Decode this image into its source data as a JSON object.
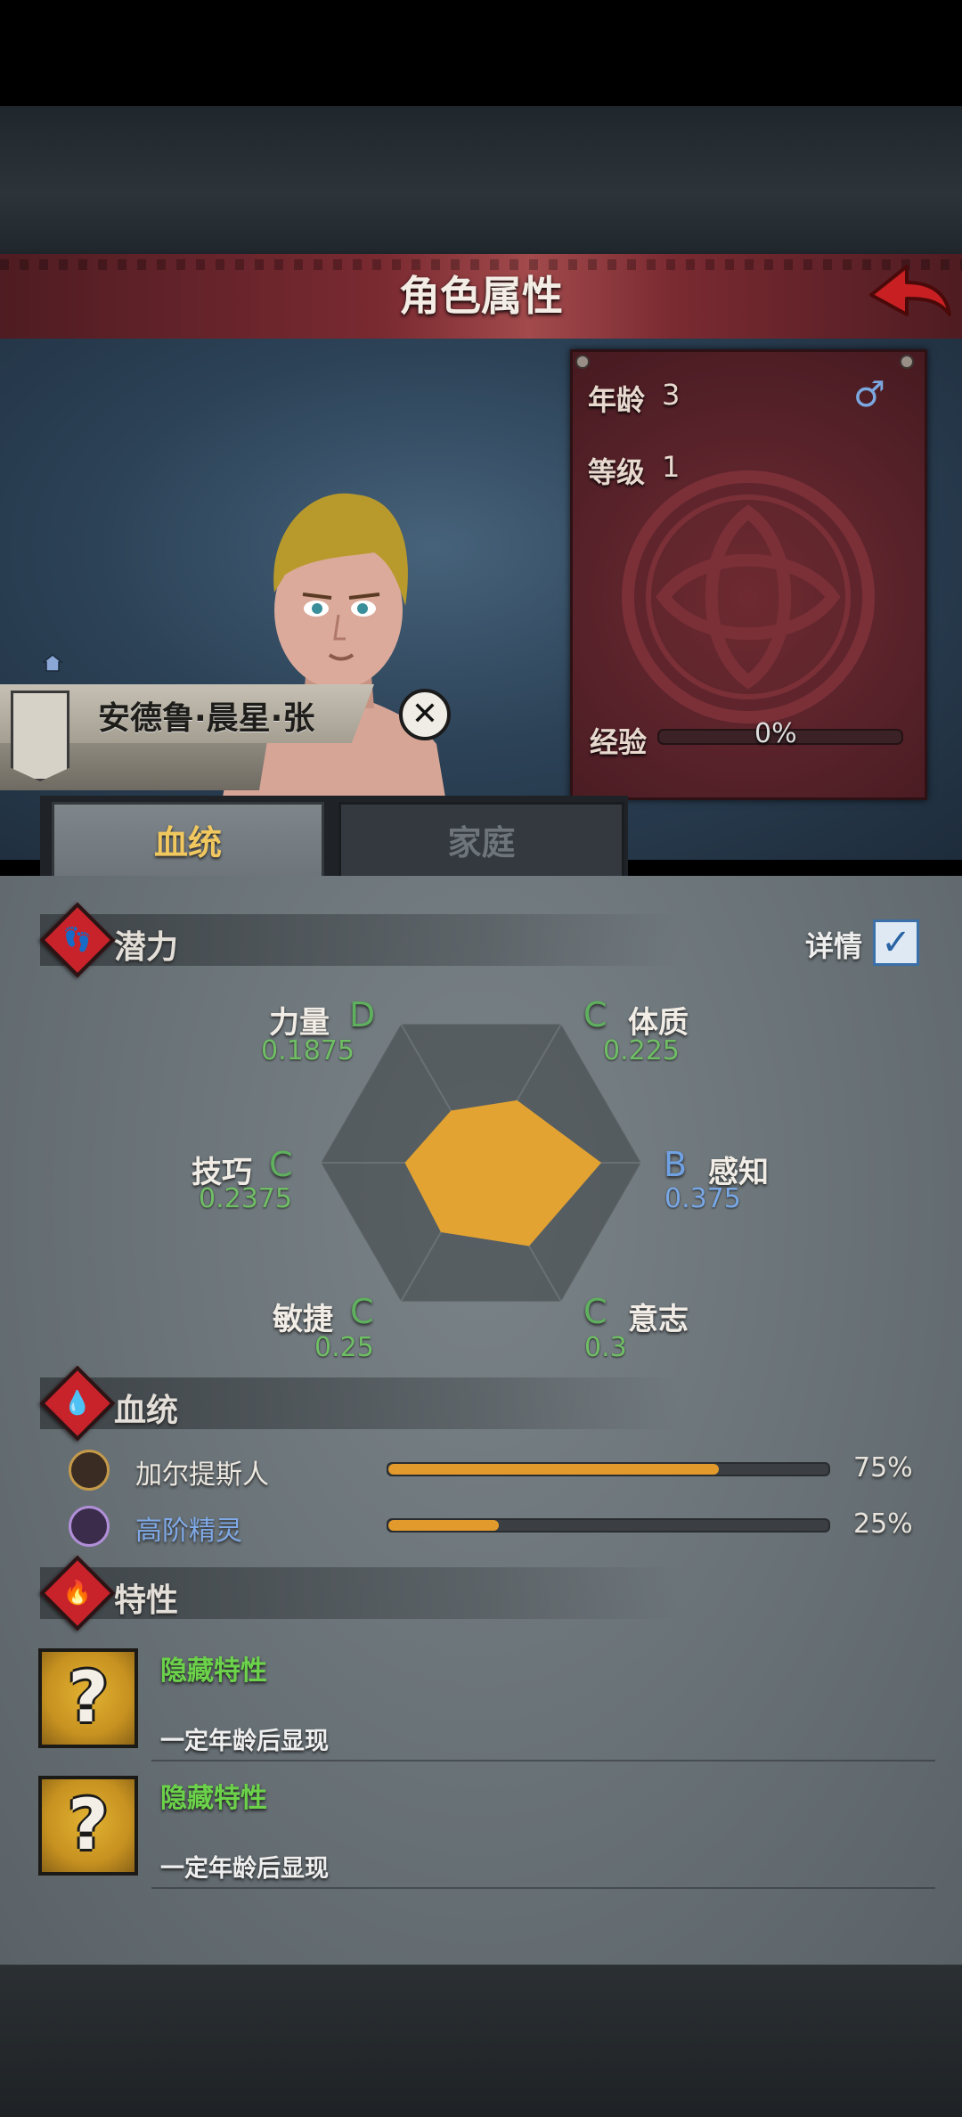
{
  "header": {
    "title": "角色属性"
  },
  "character": {
    "name": "安德鲁·晨星·张",
    "age_label": "年龄",
    "age_value": "3",
    "gender": "male",
    "gender_symbol": "♂",
    "level_label": "等级",
    "level_value": "1",
    "exp_label": "经验",
    "exp_percent_text": "0%",
    "exp_fraction": 0
  },
  "tabs": [
    {
      "label": "血统",
      "active": true
    },
    {
      "label": "家庭",
      "active": false
    }
  ],
  "potential": {
    "title": "潜力",
    "detail_label": "详情",
    "detail_checked": true,
    "attributes": [
      {
        "key": "strength",
        "name": "力量",
        "grade": "D",
        "value": "0.1875",
        "color": "green"
      },
      {
        "key": "constitution",
        "name": "体质",
        "grade": "C",
        "value": "0.225",
        "color": "green"
      },
      {
        "key": "perception",
        "name": "感知",
        "grade": "B",
        "value": "0.375",
        "color": "blue"
      },
      {
        "key": "will",
        "name": "意志",
        "grade": "C",
        "value": "0.3",
        "color": "green"
      },
      {
        "key": "agility",
        "name": "敏捷",
        "grade": "C",
        "value": "0.25",
        "color": "green"
      },
      {
        "key": "skill",
        "name": "技巧",
        "grade": "C",
        "value": "0.2375",
        "color": "green"
      }
    ]
  },
  "bloodline": {
    "title": "血统",
    "items": [
      {
        "name": "加尔提斯人",
        "percent_text": "75%",
        "fraction": 0.75,
        "name_color": "#ece8e0"
      },
      {
        "name": "高阶精灵",
        "percent_text": "25%",
        "fraction": 0.25,
        "name_color": "#7fa9e6"
      }
    ]
  },
  "traits": {
    "title": "特性",
    "items": [
      {
        "icon": "question-mark-icon",
        "title": "隐藏特性",
        "desc": "一定年龄后显现"
      },
      {
        "icon": "question-mark-icon",
        "title": "隐藏特性",
        "desc": "一定年龄后显现"
      }
    ]
  },
  "colors": {
    "header_red": "#7a2a31",
    "accent_gold": "#f1c75f",
    "radar_fill": "#e2a332",
    "grade_green": "#5fb05e",
    "grade_blue": "#6fa1e3",
    "trait_green": "#6bd24a"
  }
}
